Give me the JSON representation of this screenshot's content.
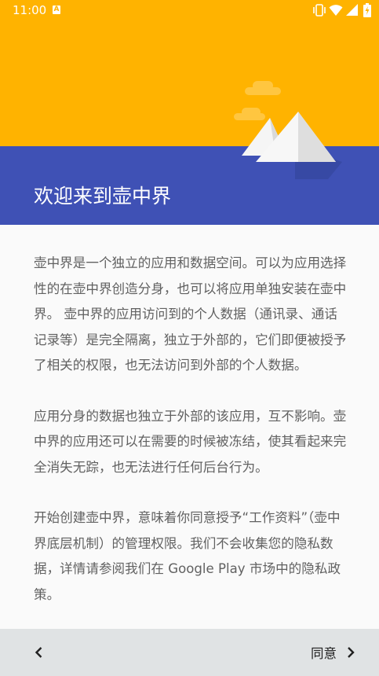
{
  "status_bar": {
    "time": "11:00",
    "notification_icon": "a-badge-icon",
    "icons": [
      "vibrate-icon",
      "wifi-icon",
      "signal-icon",
      "battery-charging-icon"
    ]
  },
  "header": {
    "title": "欢迎来到壶中界",
    "top_color": "#ffb300",
    "bottom_color": "#3f51b5"
  },
  "content": {
    "paragraphs": [
      "壶中界是一个独立的应用和数据空间。可以为应用选择性的在壶中界创造分身，也可以将应用单独安装在壶中界。 壶中界的应用访问到的个人数据（通讯录、通话记录等）是完全隔离，独立于外部的，它们即便被授予了相关的权限，也无法访问到外部的个人数据。",
      "应用分身的数据也独立于外部的该应用，互不影响。壶中界的应用还可以在需要的时候被冻结，使其看起来完全消失无踪，也无法进行任何后台行为。",
      "开始创建壶中界，意味着你同意授予“工作资料”（壶中界底层机制）的管理权限。我们不会收集您的隐私数据，详情请参阅我们在 Google Play 市场中的隐私政策。"
    ]
  },
  "bottom_bar": {
    "back_icon": "chevron-left-icon",
    "agree_label": "同意",
    "next_icon": "chevron-right-icon"
  }
}
